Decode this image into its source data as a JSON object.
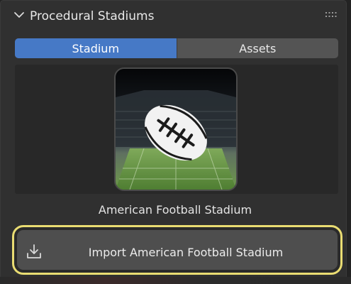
{
  "panel": {
    "title": "Procedural Stadiums",
    "collapse_icon": "chevron-down-icon",
    "grip_icon": "grip-dots-icon"
  },
  "tabs": [
    {
      "label": "Stadium",
      "active": true
    },
    {
      "label": "Assets",
      "active": false
    }
  ],
  "preview": {
    "caption": "American Football Stadium",
    "thumbnail_icon": "american-football-icon"
  },
  "import": {
    "label": "Import American Football Stadium",
    "icon": "download-icon"
  },
  "colors": {
    "accent": "#4679c6",
    "highlight": "#e9dc72",
    "panel_bg": "#303030"
  }
}
